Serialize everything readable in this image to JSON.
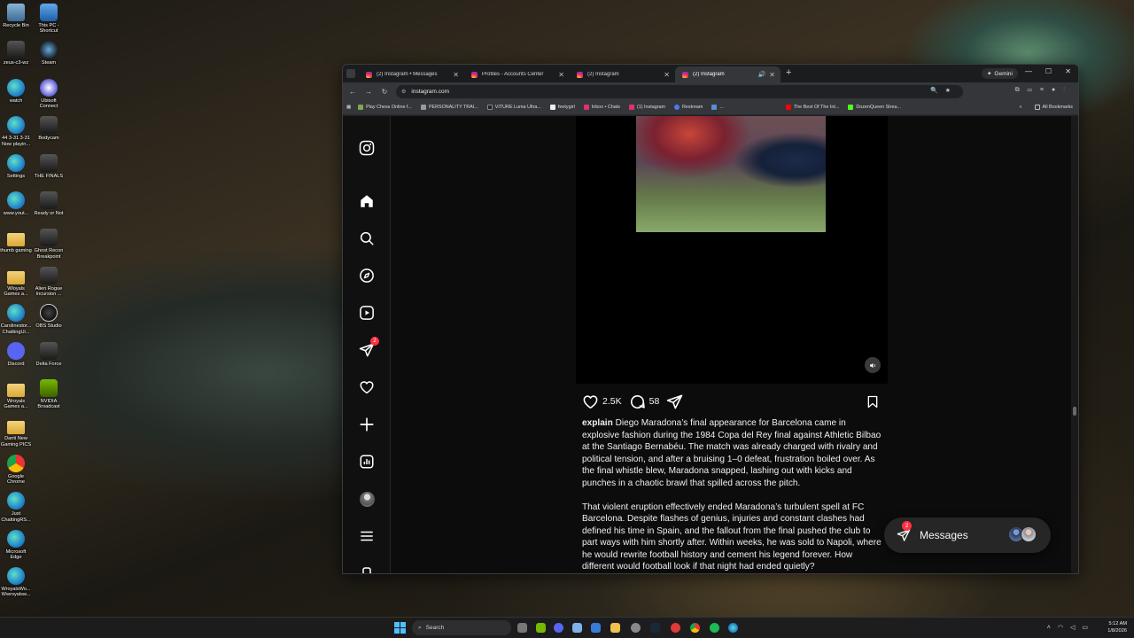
{
  "desktop": {
    "col1": [
      {
        "label": "Recycle Bin",
        "icon": "recycle-bin-icon"
      },
      {
        "label": "zeus-c3-wz",
        "icon": "app-icon"
      },
      {
        "label": "watch",
        "icon": "edge-icon"
      },
      {
        "label": "44 3-31 3-31 Now playin...",
        "icon": "edge-icon"
      },
      {
        "label": "Settings",
        "icon": "edge-icon"
      },
      {
        "label": "www.yout...",
        "icon": "edge-icon"
      },
      {
        "label": "thumb gaming",
        "icon": "folder-icon"
      },
      {
        "label": "Wloyals Games a...",
        "icon": "folder-icon"
      },
      {
        "label": "Carolinestor... ChattingUi...",
        "icon": "edge-icon"
      },
      {
        "label": "Discord",
        "icon": "discord-icon"
      },
      {
        "label": "Wroyals Games a...",
        "icon": "folder-icon"
      },
      {
        "label": "Danti New Gaming PICS",
        "icon": "folder-icon"
      },
      {
        "label": "Google Chrome",
        "icon": "chrome-icon"
      },
      {
        "label": "Just ChattingRS...",
        "icon": "edge-icon"
      },
      {
        "label": "Microsoft Edge",
        "icon": "edge-icon"
      },
      {
        "label": "WroyalsWo... Wwroyalsw...",
        "icon": "edge-icon"
      }
    ],
    "col2": [
      {
        "label": "This PC - Shortcut",
        "icon": "this-pc-icon"
      },
      {
        "label": "Steam",
        "icon": "steam-icon"
      },
      {
        "label": "Ubisoft Connect",
        "icon": "ubisoft-icon"
      },
      {
        "label": "Bodycam",
        "icon": "game-icon"
      },
      {
        "label": "THE FINALS",
        "icon": "game-icon"
      },
      {
        "label": "Ready or Not",
        "icon": "game-icon"
      },
      {
        "label": "Ghost Recon Breakpoint",
        "icon": "game-icon"
      },
      {
        "label": "Alien Rogue Incursion ...",
        "icon": "game-icon"
      },
      {
        "label": "OBS Studio",
        "icon": "obs-icon"
      },
      {
        "label": "Delta Force",
        "icon": "game-icon"
      },
      {
        "label": "NVIDIA Broadcast",
        "icon": "nvidia-icon"
      }
    ]
  },
  "browser": {
    "tabs": [
      {
        "title": "(2) Instagram • Messages",
        "active": false
      },
      {
        "title": "Profiles - Accounts Center",
        "active": false
      },
      {
        "title": "(2) Instagram",
        "active": false
      },
      {
        "title": "(2) Instagram",
        "active": true
      }
    ],
    "gemini_label": "Gemini",
    "url": "instagram.com",
    "bookmarks": [
      "Play Chess Online f...",
      "PERSONALITY TRAI...",
      "VITURE Luma Ultra...",
      "feetygirl",
      "Inbox • Chats",
      "(1) Instagram",
      "Restream",
      "...",
      "The Best Of The Int...",
      "DozenQueen Strea..."
    ],
    "all_bookmarks": "All Bookmarks"
  },
  "instagram": {
    "notifications_badge": "2",
    "likes": "2.5K",
    "comments": "58",
    "caption": {
      "username": "explain",
      "paragraph1": "Diego Maradona’s final appearance for Barcelona came in explosive fashion during the 1984 Copa del Rey final against Athletic Bilbao at the Santiago Bernabéu. The match was already charged with rivalry and political tension, and after a bruising 1–0 defeat, frustration boiled over. As the final whistle blew, Maradona snapped, lashing out with kicks and punches in a chaotic brawl that spilled across the pitch.",
      "paragraph2": "That violent eruption effectively ended Maradona’s turbulent spell at FC Barcelona. Despite flashes of genius, injuries and constant clashes had defined his time in Spain, and the fallout from the final pushed the club to part ways with him shortly after. Within weeks, he was sold to Napoli, where he would rewrite football history and cement his legend forever. How different would football look if that night had ended quietly?"
    },
    "messages": {
      "label": "Messages",
      "badge": "2"
    }
  },
  "taskbar": {
    "search_placeholder": "Search",
    "time": "5:12 AM",
    "date": "1/8/2026"
  }
}
